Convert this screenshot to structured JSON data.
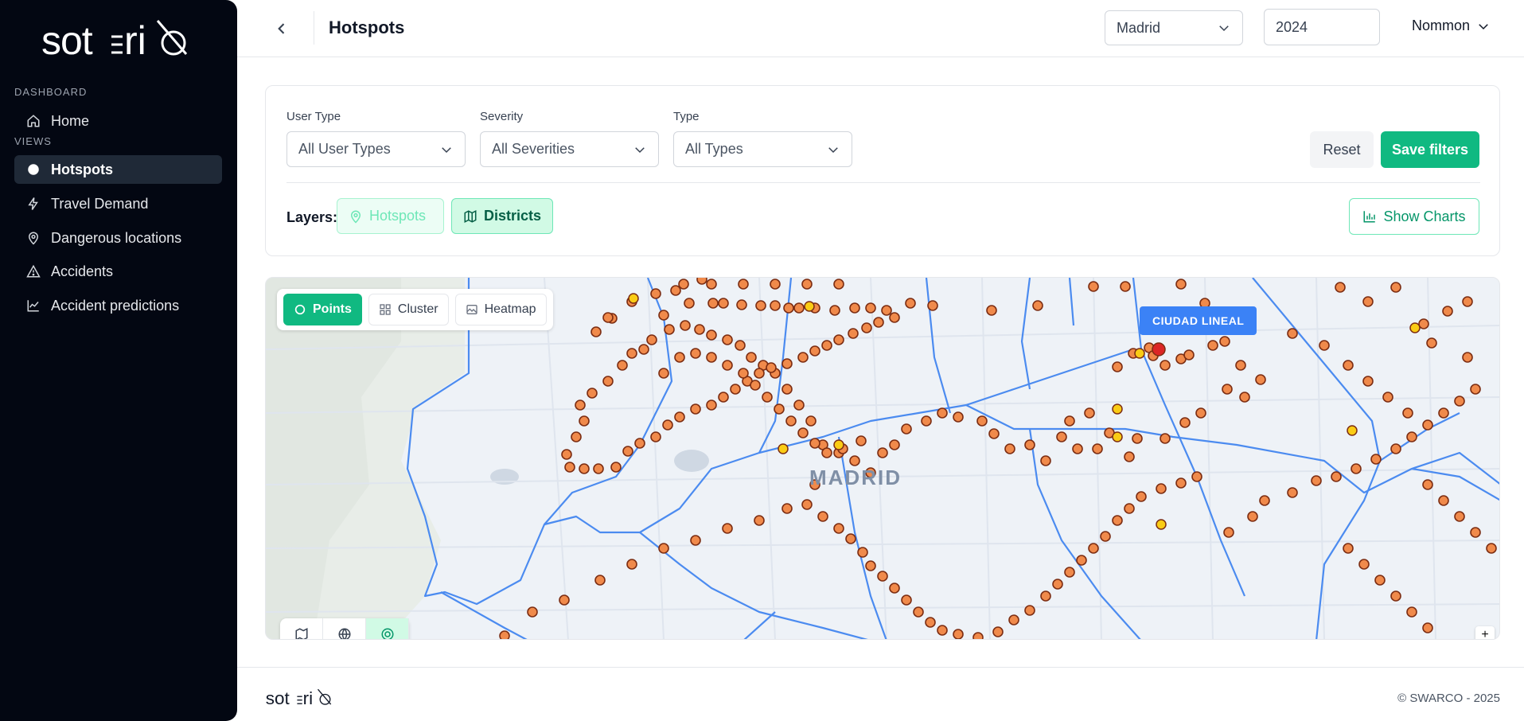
{
  "sidebar": {
    "logo_text": "soteria",
    "dashboard_label": "DASHBOARD",
    "views_label": "VIEWS",
    "home_label": "Home",
    "items": [
      {
        "label": "Hotspots",
        "icon": "dot-icon",
        "active": true
      },
      {
        "label": "Travel Demand",
        "icon": "lightning-icon",
        "active": false
      },
      {
        "label": "Dangerous locations",
        "icon": "map-pin-icon",
        "active": false
      },
      {
        "label": "Accidents",
        "icon": "warning-triangle-icon",
        "active": false
      },
      {
        "label": "Accident predictions",
        "icon": "trend-chart-icon",
        "active": false
      }
    ]
  },
  "header": {
    "title": "Hotspots",
    "city": "Madrid",
    "year": "2024",
    "user": "Nommon"
  },
  "filters": {
    "user_type_label": "User Type",
    "user_type_value": "All User Types",
    "severity_label": "Severity",
    "severity_value": "All Severities",
    "type_label": "Type",
    "type_value": "All Types",
    "reset_label": "Reset",
    "save_label": "Save filters",
    "layers_label": "Layers:",
    "layer_hotspots": "Hotspots",
    "layer_districts": "Districts",
    "show_charts_label": "Show Charts"
  },
  "map": {
    "view_points": "Points",
    "view_cluster": "Cluster",
    "view_heatmap": "Heatmap",
    "district_tag": "CIUDAD LINEAL",
    "city_label": "MADRID",
    "zoom_in": "+",
    "colors": {
      "point_fill": "#f08a4b",
      "point_stroke": "#7c2d12",
      "point_yellow": "#facc15",
      "district_line": "#4b8bf0"
    }
  },
  "footer": {
    "logo_text": "soteria",
    "copyright": "© SWARCO - 2025"
  }
}
